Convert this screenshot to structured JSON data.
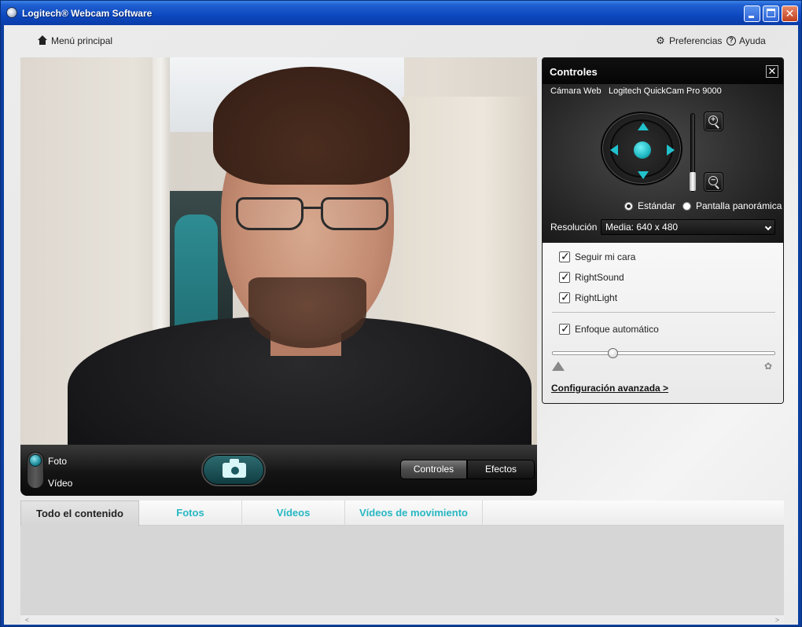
{
  "window": {
    "title": "Logitech® Webcam Software",
    "controls": {
      "minimize": "minimize",
      "maximize": "maximize",
      "close": "✕"
    }
  },
  "topnav": {
    "home_label": "Menú principal",
    "preferences_label": "Preferencias",
    "help_label": "Ayuda"
  },
  "preview_toolbar": {
    "photo_label": "Foto",
    "video_label": "Vídeo",
    "selected_mode": "Foto",
    "controls_button": "Controles",
    "effects_button": "Efectos",
    "active_segment": "Controles"
  },
  "controls_panel": {
    "title": "Controles",
    "close_glyph": "✕",
    "camera_label": "Cámara Web",
    "camera_name": "Logitech QuickCam Pro 9000",
    "view_modes": [
      {
        "label": "Estándar",
        "selected": true
      },
      {
        "label": "Pantalla panorámica",
        "selected": false
      }
    ],
    "resolution_label": "Resolución",
    "resolution_value": "Media: 640 x 480",
    "checkboxes": [
      {
        "label": "Seguir mi cara",
        "checked": true
      },
      {
        "label": "RightSound",
        "checked": true
      },
      {
        "label": "RightLight",
        "checked": true
      }
    ],
    "autofocus": {
      "label": "Enfoque automático",
      "checked": true
    },
    "focus_level": 0.29,
    "zoom_level": 0.0,
    "advanced_link": "Configuración avanzada >"
  },
  "library": {
    "tabs": [
      {
        "label": "Todo el contenido",
        "active": true
      },
      {
        "label": "Fotos",
        "active": false
      },
      {
        "label": "Vídeos",
        "active": false
      },
      {
        "label": "Vídeos de movimiento",
        "active": false
      }
    ],
    "scroll_left": "<",
    "scroll_right": ">"
  },
  "colors": {
    "accent": "#27b7c2",
    "titlebar": "#0d48c0",
    "panel_dark": "#262626"
  },
  "icons": {
    "home": "home-icon",
    "preferences": "gear-icon",
    "help": "help-icon",
    "capture": "camera-icon",
    "zoom_in": "zoom-in-icon",
    "zoom_out": "zoom-out-icon",
    "focus_far": "mountain-icon",
    "focus_near": "flower-icon"
  }
}
